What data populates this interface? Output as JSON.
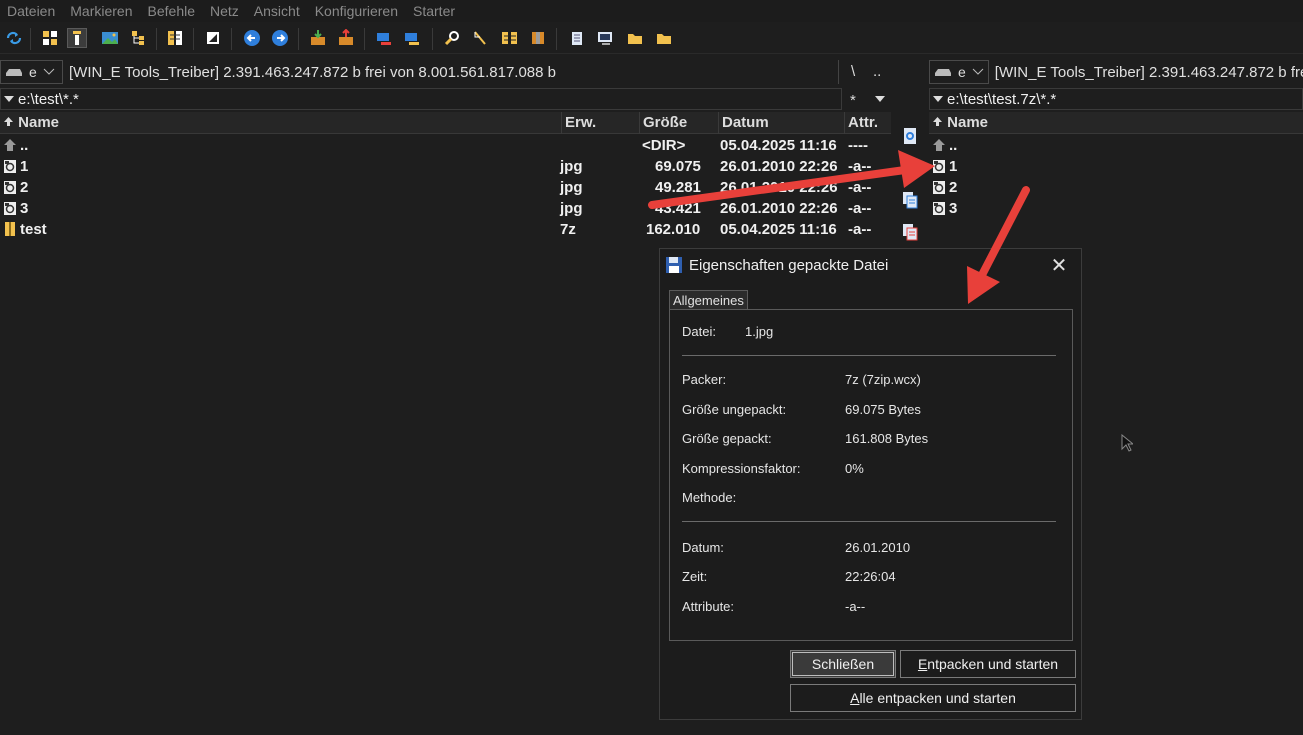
{
  "menu": [
    "Dateien",
    "Markieren",
    "Befehle",
    "Netz",
    "Ansicht",
    "Konfigurieren",
    "Starter"
  ],
  "left": {
    "drive": "e",
    "drive_info": "[WIN_E Tools_Treiber]  2.391.463.247.872 b frei von 8.001.561.817.088 b",
    "root_btn": "\\",
    "up_btn": "..",
    "path": "e:\\test\\*.*",
    "filter": "*",
    "columns": {
      "name": "Name",
      "ext": "Erw.",
      "size": "Größe",
      "date": "Datum",
      "attr": "Attr."
    },
    "rows": [
      {
        "name": "..",
        "ext": "",
        "size": "<DIR>",
        "date": "05.04.2025 11:16",
        "attr": "----"
      },
      {
        "name": "1",
        "ext": "jpg",
        "size": "69.075",
        "date": "26.01.2010 22:26",
        "attr": "-a--"
      },
      {
        "name": "2",
        "ext": "jpg",
        "size": "49.281",
        "date": "26.01.2010 22:26",
        "attr": "-a--"
      },
      {
        "name": "3",
        "ext": "jpg",
        "size": "43.421",
        "date": "26.01.2010 22:26",
        "attr": "-a--"
      },
      {
        "name": "test",
        "ext": "7z",
        "size": "162.010",
        "date": "05.04.2025 11:16",
        "attr": "-a--"
      }
    ]
  },
  "right": {
    "drive": "e",
    "drive_info": "[WIN_E Tools_Treiber]  2.391.463.247.872 b fre",
    "path": "e:\\test\\test.7z\\*.*",
    "columns": {
      "name": "Name"
    },
    "rows": [
      {
        "name": ".."
      },
      {
        "name": "1"
      },
      {
        "name": "2"
      },
      {
        "name": "3"
      }
    ]
  },
  "dialog": {
    "title": "Eigenschaften gepackte Datei",
    "close": "✕",
    "tab": "Allgemeines",
    "datei_label": "Datei:",
    "datei_value": "1.jpg",
    "packer_label": "Packer:",
    "packer_value": "7z (7zip.wcx)",
    "size_unpacked_label": "Größe ungepackt:",
    "size_unpacked_value": "69.075 Bytes",
    "size_packed_label": "Größe gepackt:",
    "size_packed_value": "161.808 Bytes",
    "ratio_label": "Kompressionsfaktor:",
    "ratio_value": "0%",
    "method_label": "Methode:",
    "date_label": "Datum:",
    "date_value": "26.01.2010",
    "time_label": "Zeit:",
    "time_value": "22:26:04",
    "attr_label": "Attribute:",
    "attr_value": "-a--",
    "btn_close": "Schließen",
    "btn_extract_run_u": "E",
    "btn_extract_run": "ntpacken und starten",
    "btn_extract_all_u": "A",
    "btn_extract_all": "lle entpacken und starten"
  },
  "colors": {
    "arrow": "#e8403a",
    "accent_blue": "#2f7fdc",
    "folder": "#f2c14e"
  }
}
